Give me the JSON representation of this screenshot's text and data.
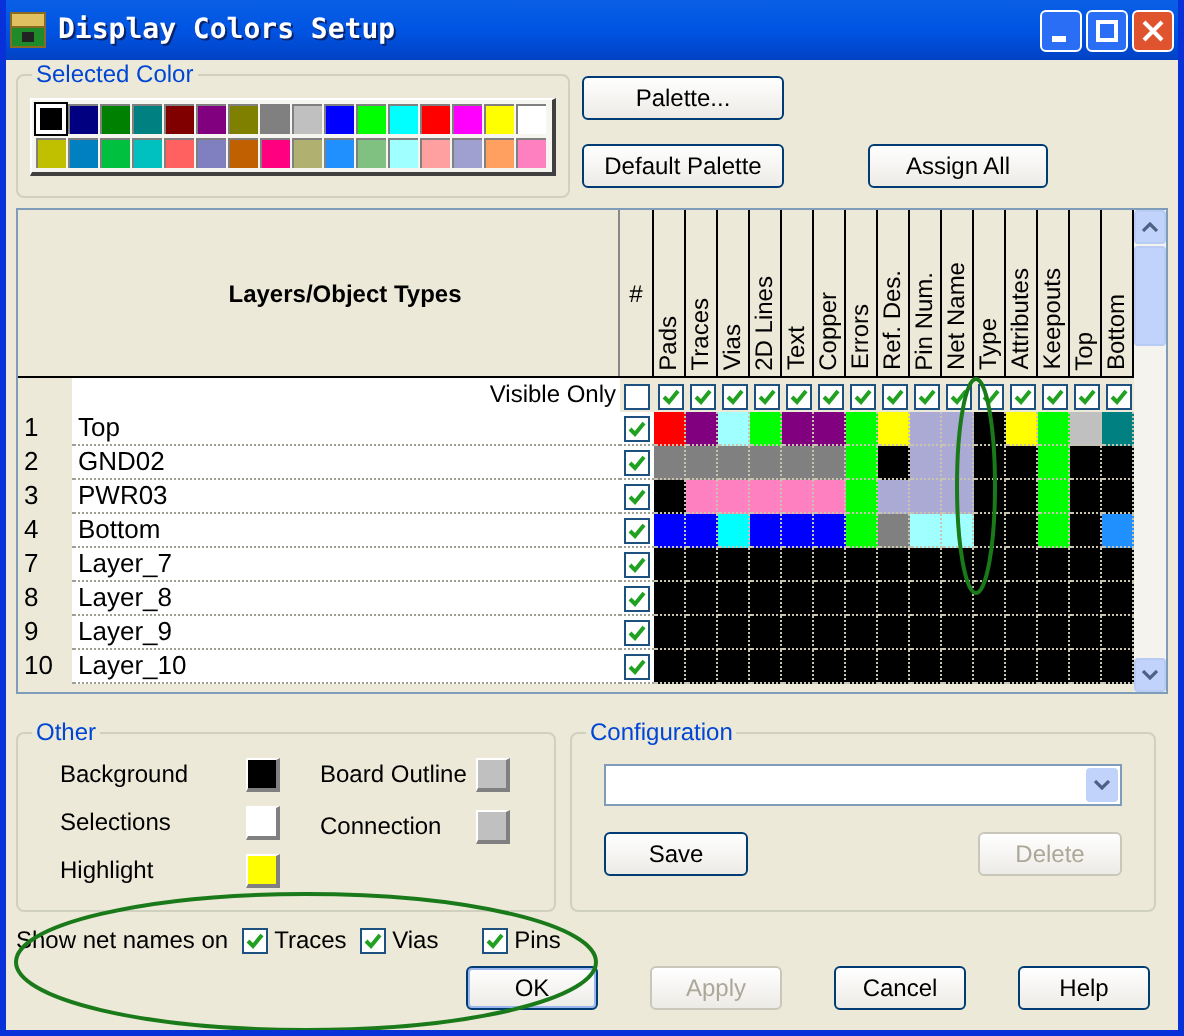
{
  "window": {
    "title": "Display Colors Setup"
  },
  "selected_color": {
    "label": "Selected Color",
    "palette": [
      {
        "color": "#000000",
        "selected": true
      },
      {
        "color": "#000080",
        "selected": false
      },
      {
        "color": "#008000",
        "selected": false
      },
      {
        "color": "#008080",
        "selected": false
      },
      {
        "color": "#800000",
        "selected": false
      },
      {
        "color": "#800080",
        "selected": false
      },
      {
        "color": "#808000",
        "selected": false
      },
      {
        "color": "#808080",
        "selected": false
      },
      {
        "color": "#c0c0c0",
        "selected": false
      },
      {
        "color": "#0000ff",
        "selected": false
      },
      {
        "color": "#00ff00",
        "selected": false
      },
      {
        "color": "#00ffff",
        "selected": false
      },
      {
        "color": "#ff0000",
        "selected": false
      },
      {
        "color": "#ff00ff",
        "selected": false
      },
      {
        "color": "#ffff00",
        "selected": false
      },
      {
        "color": "#ffffff",
        "selected": false
      },
      {
        "color": "#c0c000",
        "selected": false
      },
      {
        "color": "#0080c0",
        "selected": false
      },
      {
        "color": "#00c040",
        "selected": false
      },
      {
        "color": "#00c0c0",
        "selected": false
      },
      {
        "color": "#ff6060",
        "selected": false
      },
      {
        "color": "#8080c0",
        "selected": false
      },
      {
        "color": "#c06000",
        "selected": false
      },
      {
        "color": "#ff0080",
        "selected": false
      },
      {
        "color": "#b0b070",
        "selected": false
      },
      {
        "color": "#2090ff",
        "selected": false
      },
      {
        "color": "#80c080",
        "selected": false
      },
      {
        "color": "#a0ffff",
        "selected": false
      },
      {
        "color": "#ffa0a0",
        "selected": false
      },
      {
        "color": "#a0a0d0",
        "selected": false
      },
      {
        "color": "#ffa060",
        "selected": false
      },
      {
        "color": "#ff80c0",
        "selected": false
      }
    ]
  },
  "palette_buttons": [
    {
      "label": "Palette..."
    },
    {
      "label": "Default Palette"
    },
    {
      "label": "Assign All"
    }
  ],
  "grid": {
    "heading": "Layers/Object Types",
    "number_heading": "#",
    "columns": [
      "Pads",
      "Traces",
      "Vias",
      "2D Lines",
      "Text",
      "Copper",
      "Errors",
      "Ref. Des.",
      "Pin Num.",
      "Net Name",
      "Type",
      "Attributes",
      "Keepouts",
      "Top",
      "Bottom"
    ],
    "visible_only": {
      "label": "Visible Only",
      "checked": false,
      "columns_checked": [
        true,
        true,
        true,
        true,
        true,
        true,
        true,
        true,
        true,
        true,
        true,
        true,
        true,
        true,
        true
      ]
    },
    "layers": [
      {
        "number": "1",
        "name": "Top",
        "visible": true,
        "cells": [
          {
            "color": "#ff0000"
          },
          {
            "color": "#800080"
          },
          {
            "color": "#a0ffff"
          },
          {
            "color": "#00ff00"
          },
          {
            "color": "#800080"
          },
          {
            "color": "#800080"
          },
          {
            "color": "#00ff00"
          },
          {
            "color": "#ffff00"
          },
          {
            "color": "#aaaad4"
          },
          {
            "color": "#aaaad4"
          },
          {
            "color": "#000000"
          },
          {
            "color": "#ffff00"
          },
          {
            "color": "#00ff00"
          },
          {
            "color": "#c0c0c0"
          },
          {
            "color": "#008080"
          }
        ]
      },
      {
        "number": "2",
        "name": "GND02",
        "visible": true,
        "cells": [
          {
            "color": "#808080"
          },
          {
            "color": "#808080"
          },
          {
            "color": "#808080"
          },
          {
            "color": "#808080"
          },
          {
            "color": "#808080"
          },
          {
            "color": "#808080"
          },
          {
            "color": "#00ff00"
          },
          {
            "color": "#000000"
          },
          {
            "color": "#aaaad4"
          },
          {
            "color": "#aaaad4"
          },
          {
            "color": "#000000"
          },
          {
            "color": "#000000"
          },
          {
            "color": "#00ff00"
          },
          {
            "color": "#000000"
          },
          {
            "color": "#000000"
          }
        ]
      },
      {
        "number": "3",
        "name": "PWR03",
        "visible": true,
        "cells": [
          {
            "color": "#000000"
          },
          {
            "color": "#ff80c0"
          },
          {
            "color": "#ff80c0"
          },
          {
            "color": "#ff80c0"
          },
          {
            "color": "#ff80c0"
          },
          {
            "color": "#ff80c0"
          },
          {
            "color": "#00ff00"
          },
          {
            "color": "#aaaad4"
          },
          {
            "color": "#aaaad4"
          },
          {
            "color": "#aaaad4"
          },
          {
            "color": "#000000"
          },
          {
            "color": "#000000"
          },
          {
            "color": "#00ff00"
          },
          {
            "color": "#000000"
          },
          {
            "color": "#000000"
          }
        ]
      },
      {
        "number": "4",
        "name": "Bottom",
        "visible": true,
        "cells": [
          {
            "color": "#0000ff"
          },
          {
            "color": "#0000ff"
          },
          {
            "color": "#00ffff"
          },
          {
            "color": "#0000ff"
          },
          {
            "color": "#0000ff"
          },
          {
            "color": "#0000ff"
          },
          {
            "color": "#00ff00"
          },
          {
            "color": "#808080"
          },
          {
            "color": "#a0ffff"
          },
          {
            "color": "#a0ffff"
          },
          {
            "color": "#000000"
          },
          {
            "color": "#000000"
          },
          {
            "color": "#00ff00"
          },
          {
            "color": "#000000"
          },
          {
            "color": "#2090ff"
          }
        ]
      },
      {
        "number": "7",
        "name": "Layer_7",
        "visible": true,
        "cells": [
          {
            "color": "#000000"
          },
          {
            "color": "#000000"
          },
          {
            "color": "#000000"
          },
          {
            "color": "#000000"
          },
          {
            "color": "#000000"
          },
          {
            "color": "#000000"
          },
          {
            "color": "#000000"
          },
          {
            "color": "#000000"
          },
          {
            "color": "#000000"
          },
          {
            "color": "#000000"
          },
          {
            "color": "#000000"
          },
          {
            "color": "#000000"
          },
          {
            "color": "#000000"
          },
          {
            "color": "#000000"
          },
          {
            "color": "#000000"
          }
        ]
      },
      {
        "number": "8",
        "name": "Layer_8",
        "visible": true,
        "cells": [
          {
            "color": "#000000"
          },
          {
            "color": "#000000"
          },
          {
            "color": "#000000"
          },
          {
            "color": "#000000"
          },
          {
            "color": "#000000"
          },
          {
            "color": "#000000"
          },
          {
            "color": "#000000"
          },
          {
            "color": "#000000"
          },
          {
            "color": "#000000"
          },
          {
            "color": "#000000"
          },
          {
            "color": "#000000"
          },
          {
            "color": "#000000"
          },
          {
            "color": "#000000"
          },
          {
            "color": "#000000"
          },
          {
            "color": "#000000"
          }
        ]
      },
      {
        "number": "9",
        "name": "Layer_9",
        "visible": true,
        "cells": [
          {
            "color": "#000000"
          },
          {
            "color": "#000000"
          },
          {
            "color": "#000000"
          },
          {
            "color": "#000000"
          },
          {
            "color": "#000000"
          },
          {
            "color": "#000000"
          },
          {
            "color": "#000000"
          },
          {
            "color": "#000000"
          },
          {
            "color": "#000000"
          },
          {
            "color": "#000000"
          },
          {
            "color": "#000000"
          },
          {
            "color": "#000000"
          },
          {
            "color": "#000000"
          },
          {
            "color": "#000000"
          },
          {
            "color": "#000000"
          }
        ]
      },
      {
        "number": "10",
        "name": "Layer_10",
        "visible": true,
        "cells": [
          {
            "color": "#000000"
          },
          {
            "color": "#000000"
          },
          {
            "color": "#000000"
          },
          {
            "color": "#000000"
          },
          {
            "color": "#000000"
          },
          {
            "color": "#000000"
          },
          {
            "color": "#000000"
          },
          {
            "color": "#000000"
          },
          {
            "color": "#000000"
          },
          {
            "color": "#000000"
          },
          {
            "color": "#000000"
          },
          {
            "color": "#000000"
          },
          {
            "color": "#000000"
          },
          {
            "color": "#000000"
          },
          {
            "color": "#000000"
          }
        ]
      }
    ]
  },
  "other": {
    "label": "Other",
    "left": [
      {
        "label": "Background",
        "color": "#000000"
      },
      {
        "label": "Selections",
        "color": "#ffffff"
      },
      {
        "label": "Highlight",
        "color": "#ffff00"
      }
    ],
    "right": [
      {
        "label": "Board Outline",
        "color": "#c0c0c0"
      },
      {
        "label": "Connection",
        "color": "#c0c0c0"
      }
    ]
  },
  "configuration": {
    "label": "Configuration",
    "buttons": [
      {
        "label": "Save",
        "disabled": false
      },
      {
        "label": "Delete",
        "disabled": true
      }
    ]
  },
  "net_names": {
    "label": "Show net names on",
    "options": [
      {
        "label": "Traces",
        "checked": true
      },
      {
        "label": "Vias",
        "checked": true
      },
      {
        "label": "Pins",
        "checked": true
      }
    ]
  },
  "footer_buttons": [
    {
      "label": "OK",
      "disabled": false,
      "default": true
    },
    {
      "label": "Apply",
      "disabled": true,
      "default": false
    },
    {
      "label": "Cancel",
      "disabled": false,
      "default": false
    },
    {
      "label": "Help",
      "disabled": false,
      "default": false
    }
  ]
}
